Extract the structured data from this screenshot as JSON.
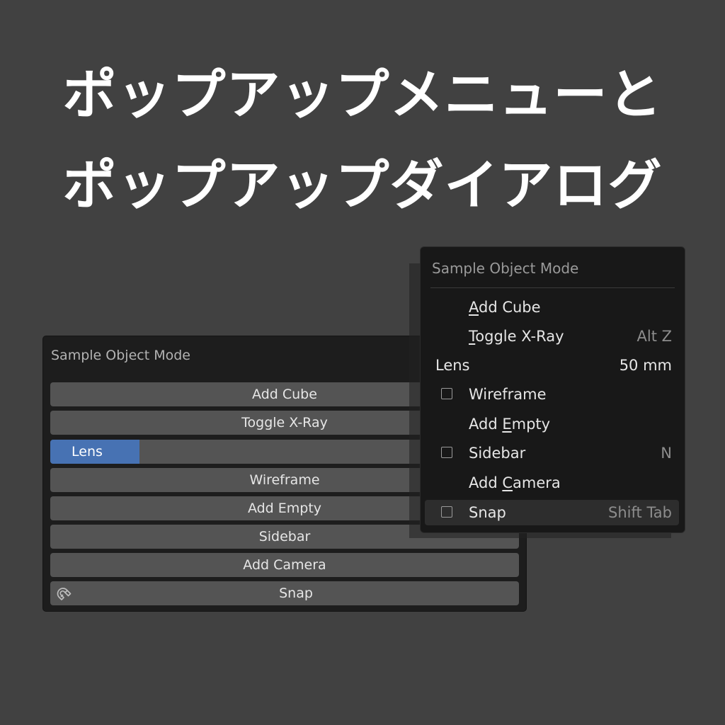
{
  "headline": {
    "line1": "ポップアップメニューと",
    "line2": "ポップアップダイアログ"
  },
  "dialog": {
    "title": "Sample Object Mode",
    "buttons": [
      "Add Cube",
      "Toggle X-Ray",
      "Wireframe",
      "Add Empty",
      "Sidebar",
      "Add Camera",
      "Snap"
    ],
    "slider": {
      "label": "Lens",
      "fill_fraction": 0.19
    },
    "snap_icon": "magnet-icon"
  },
  "menu": {
    "title": "Sample Object Mode",
    "items": [
      {
        "pre": "",
        "key": "A",
        "post": "dd Cube",
        "shortcut": ""
      },
      {
        "pre": "",
        "key": "T",
        "post": "oggle X-Ray",
        "shortcut": "Alt Z"
      },
      {
        "label": "Lens",
        "value": "50 mm"
      },
      {
        "pre": "Wireframe",
        "key": "",
        "post": "",
        "shortcut": ""
      },
      {
        "pre": "Add ",
        "key": "E",
        "post": "mpty",
        "shortcut": ""
      },
      {
        "pre": "Sidebar",
        "key": "",
        "post": "",
        "shortcut": "N"
      },
      {
        "pre": "Add ",
        "key": "C",
        "post": "amera",
        "shortcut": ""
      },
      {
        "pre": "Snap",
        "key": "",
        "post": "",
        "shortcut": "Shift Tab"
      }
    ]
  },
  "colors": {
    "background": "#414141",
    "panel": "#1d1d1d",
    "button": "#545454",
    "accent": "#4772b3"
  }
}
